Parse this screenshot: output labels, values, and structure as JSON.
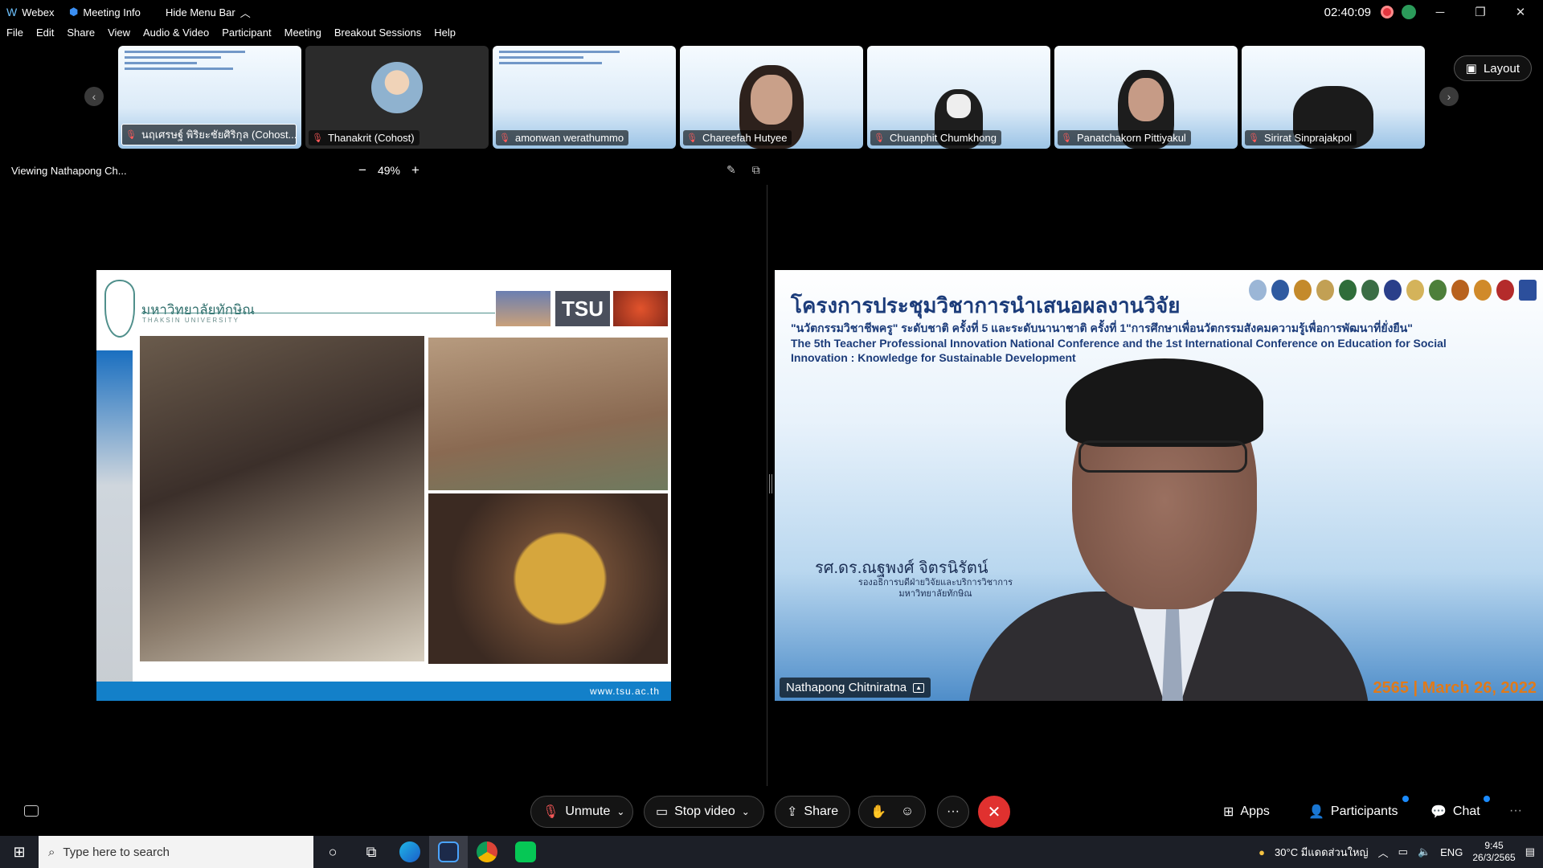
{
  "titlebar": {
    "app_name": "Webex",
    "meeting_info": "Meeting Info",
    "hide_menu": "Hide Menu Bar",
    "timer": "02:40:09",
    "minimize": "─",
    "restore": "❐",
    "close": "✕"
  },
  "menu": [
    "File",
    "Edit",
    "Share",
    "View",
    "Audio & Video",
    "Participant",
    "Meeting",
    "Breakout Sessions",
    "Help"
  ],
  "filmstrip": {
    "prev": "‹",
    "next": "›",
    "layout_label": "Layout",
    "participants": [
      {
        "name": "นฤเศรษฐ์ พิริยะชัยศิริกุล (Cohost...)",
        "kind": "slide"
      },
      {
        "name": "Thanakrit (Cohost)",
        "kind": "avatar"
      },
      {
        "name": "amonwan werathummo",
        "kind": "slide"
      },
      {
        "name": "Chareefah Hutyee",
        "kind": "person"
      },
      {
        "name": "Chuanphit Chumkhong",
        "kind": "person"
      },
      {
        "name": "Panatchakorn Pittiyakul",
        "kind": "person"
      },
      {
        "name": "Sirirat Sinprajakpol",
        "kind": "person"
      }
    ]
  },
  "viewer": {
    "viewing_label": "Viewing Nathapong Ch...",
    "zoom_minus": "−",
    "zoom_value": "49%",
    "zoom_plus": "+"
  },
  "shared_slide": {
    "university_th": "มหาวิทยาลัยทักษิณ",
    "university_en": "THAKSIN UNIVERSITY",
    "thumb_label": "TSU",
    "footer_url": "www.tsu.ac.th"
  },
  "speaker": {
    "heading": "โครงการประชุมวิชาการนำเสนอผลงานวิจัย",
    "subheading": "\"นวัตกรรมวิชาชีพครู\" ระดับชาติ ครั้งที่ 5 และระดับนานาชาติ ครั้งที่ 1\"การศึกษาเพื่อนวัตกรรมสังคมความรู้เพื่อการพัฒนาที่ยั่งยืน\"",
    "english_title": "The 5th Teacher Professional Innovation National Conference and the 1st International Conference on Education for Social Innovation : Knowledge for Sustainable Development",
    "person_name_th": "รศ.ดร.ณฐพงศ์ จิตรนิรัตน์",
    "person_title_th": "รองอธิการบดีฝ่ายวิจัยและบริการวิชาการ มหาวิทยาลัยทักษิณ",
    "date": "2565 | March 26, 2022",
    "name_tag": "Nathapong Chitniratna"
  },
  "controls": {
    "unmute": "Unmute",
    "stop_video": "Stop video",
    "share": "Share",
    "more": "···",
    "end": "✕",
    "apps": "Apps",
    "participants": "Participants",
    "chat": "Chat",
    "overflow": "···"
  },
  "taskbar": {
    "search_placeholder": "Type here to search",
    "weather": "30°C  มีแดดส่วนใหญ่",
    "lang": "ENG",
    "time": "9:45",
    "date": "26/3/2565"
  },
  "colors": {
    "end_call": "#e0312f",
    "mic_off": "#ff5a5a",
    "date_orange": "#e07a1a"
  }
}
